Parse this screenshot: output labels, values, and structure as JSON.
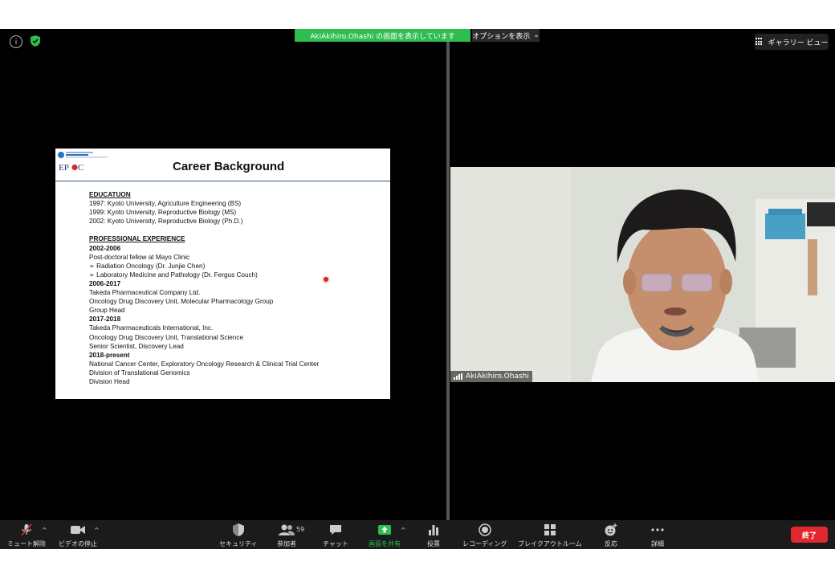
{
  "banner": {
    "sharing_text": "AkiAkihiro.Ohashi の画面を表示しています",
    "options_label": "オプションを表示",
    "gallery_label": "ギャラリー ビュー"
  },
  "slide": {
    "title": "Career Background",
    "lines": [
      {
        "text": "EDUCATUON",
        "style": "h"
      },
      {
        "text": "1997: Kyoto University, Agriculture Engineering (BS)",
        "style": ""
      },
      {
        "text": "1999: Kyoto University, Reproductive Biology (MS)",
        "style": ""
      },
      {
        "text": "2002: Kyoto University, Reproductive Biology (Ph.D.)",
        "style": ""
      },
      {
        "text": "",
        "style": "gap"
      },
      {
        "text": "PROFESSIONAL EXPERIENCE",
        "style": "h"
      },
      {
        "text": "2002-2006",
        "style": "b"
      },
      {
        "text": "Post-doctoral fellow at Mayo Clinic",
        "style": ""
      },
      {
        "text": "➢  Radiation Oncology (Dr. Junjie Chen)",
        "style": ""
      },
      {
        "text": "➢  Laboratory Medicine and Pathology (Dr. Fergus Couch)",
        "style": ""
      },
      {
        "text": "2006-2017",
        "style": "b"
      },
      {
        "text": "Takeda Pharmaceutical Company Ltd.",
        "style": ""
      },
      {
        "text": "Oncology Drug Discovery Unit, Molecular Pharmacology Group",
        "style": ""
      },
      {
        "text": "Group Head",
        "style": ""
      },
      {
        "text": "2017-2018",
        "style": "b"
      },
      {
        "text": "Takeda Pharmaceuticals International, Inc.",
        "style": ""
      },
      {
        "text": "Oncology Drug Discovery Unit, Translational Science",
        "style": ""
      },
      {
        "text": "Senior Scientist, Discovery Lead",
        "style": ""
      },
      {
        "text": "2018-present",
        "style": "b"
      },
      {
        "text": "National Cancer Center, Exploratory Oncology Research & Clinical Trial Center",
        "style": ""
      },
      {
        "text": "Division of Translational Genomics",
        "style": ""
      },
      {
        "text": "Division Head",
        "style": ""
      }
    ]
  },
  "video": {
    "participant_name": "AkiAkihiro.Ohashi"
  },
  "toolbar": {
    "unmute": "ミュート解除",
    "stop_video": "ビデオの停止",
    "security": "セキュリティ",
    "participants": "参加者",
    "participants_count": "59",
    "chat": "チャット",
    "share_screen": "画面を共有",
    "polls": "投票",
    "recording": "レコーディング",
    "breakout": "ブレイクアウトルーム",
    "reactions": "反応",
    "more": "詳細",
    "end": "終了"
  },
  "colors": {
    "share_green": "#2dbe4f",
    "end_red": "#e0282e",
    "toolbar_bg": "#1b1b1b"
  }
}
